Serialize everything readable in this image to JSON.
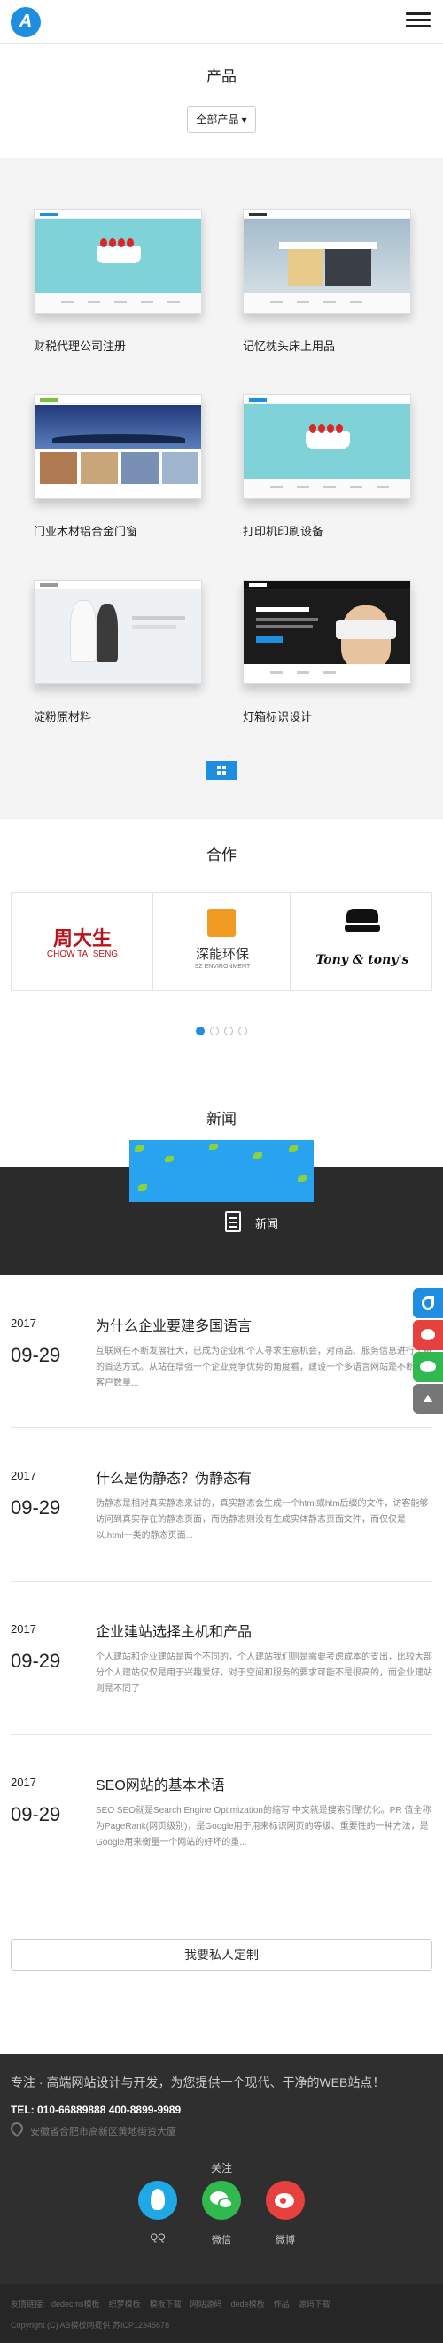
{
  "header": {
    "logo_letter": "A",
    "menu_icon": "hamburger-icon"
  },
  "products": {
    "title": "产品",
    "filter_label": "全部产品 ▾",
    "items": [
      {
        "label": "财税代理公司注册"
      },
      {
        "label": "记忆枕头床上用品"
      },
      {
        "label": "门业木材铝合金门窗"
      },
      {
        "label": "打印机印刷设备"
      },
      {
        "label": "淀粉原材料"
      },
      {
        "label": "灯箱标识设计"
      }
    ]
  },
  "partners": {
    "title": "合作",
    "logos": [
      {
        "cn": "周大生",
        "en": "CHOW TAI SENG"
      },
      {
        "cn": "深能环保",
        "en": "SZ ENVIRONMENT"
      },
      {
        "cn": "",
        "en": "Tony & tony's"
      }
    ]
  },
  "news": {
    "title": "新闻",
    "banner_label": "新闻",
    "items": [
      {
        "year": "2017",
        "date": "09-29",
        "title": "为什么企业要建多国语言",
        "desc": "互联网在不断发展壮大，已成为企业和个人寻求生意机会，对商品、服务信息进行了解的首选方式。从站在增强一个企业竞争优势的角度看，建设一个多语言网站是不断增加客户数量..."
      },
      {
        "year": "2017",
        "date": "09-29",
        "title": "什么是伪静态？伪静态有",
        "desc": "伪静态是相对真实静态来讲的，真实静态会生成一个html或htm后缀的文件，访客能够访问到真实存在的静态页面，而伪静态则没有生成实体静态页面文件，而仅仅是以.html一类的静态页面..."
      },
      {
        "year": "2017",
        "date": "09-29",
        "title": "企业建站选择主机和产品",
        "desc": "个人建站和企业建站是两个不同的，个人建站我们则是需要考虑成本的支出，比较大部分个人建站仅仅是用于兴趣爱好，对于空间和服务的要求可能不是很高的，而企业建站则是不同了..."
      },
      {
        "year": "2017",
        "date": "09-29",
        "title": "SEO网站的基本术语",
        "desc": "SEO SEO就是Search Engine Optimization的缩写,中文就是搜索引擎优化。PR 值全称为PageRank(网页级别)，是Google用于用来标识网页的等级、重要性的一种方法，是Google用来衡量一个网站的好坏的重..."
      }
    ]
  },
  "custom_button": "我要私人定制",
  "footer": {
    "slogan": "专注 · 高端网站设计与开发，为您提供一个现代、干净的WEB站点！",
    "tel": "TEL: 010-66889888 400-8899-9989",
    "address": "安徽省合肥市高新区黄地街资大厦",
    "follow_label": "关注",
    "social": [
      {
        "label": "QQ",
        "color": "#1ea8e6"
      },
      {
        "label": "微信",
        "color": "#2fb94f"
      },
      {
        "label": "微博",
        "color": "#e6413e"
      }
    ],
    "links": [
      "友情链接:",
      "dedecms模板",
      "织梦模板",
      "模板下载",
      "网站源码",
      "dede模板",
      "作品",
      "源码下载"
    ],
    "copyright": "Copyright (C) AB模板网提供 苏ICP12345678"
  },
  "colors": {
    "accent": "#1e8ee0",
    "dark": "#2b2b2b"
  }
}
